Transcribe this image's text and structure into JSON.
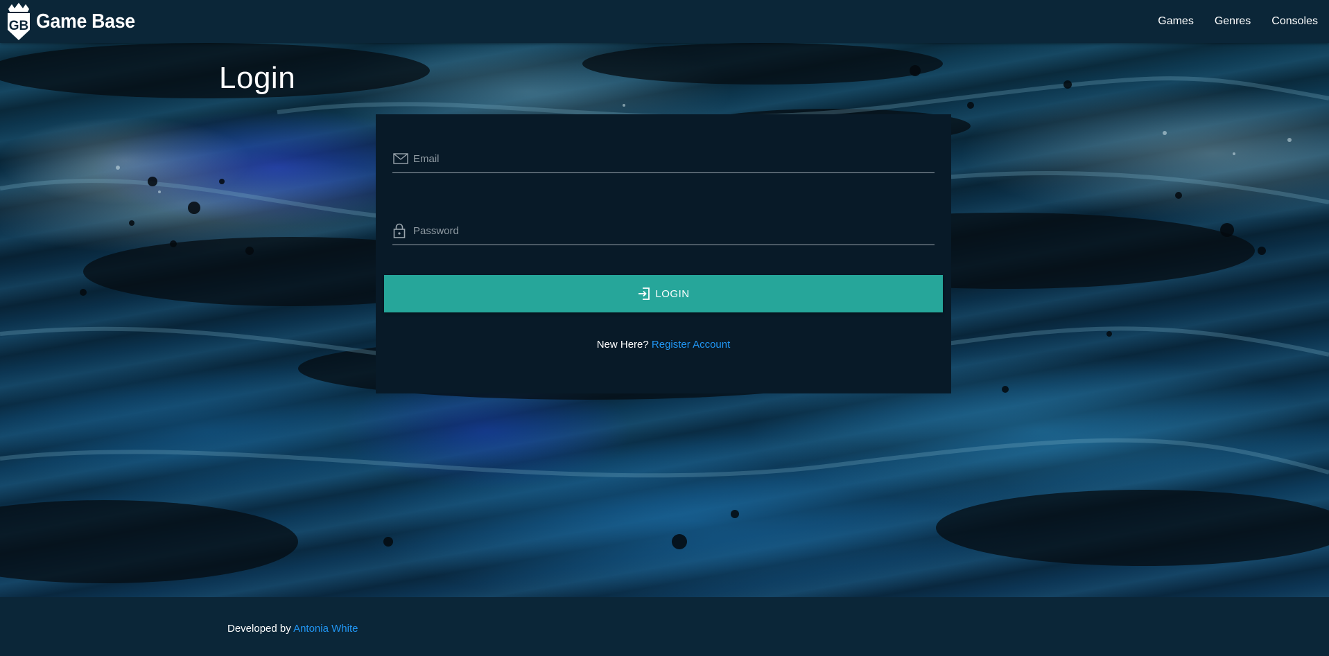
{
  "navbar": {
    "brand_name": "Game Base",
    "logo_icon": "gb-crown-shield-logo",
    "links": [
      {
        "label": "Games"
      },
      {
        "label": "Genres"
      },
      {
        "label": "Consoles"
      }
    ]
  },
  "page": {
    "title": "Login"
  },
  "form": {
    "email": {
      "placeholder": "Email",
      "value": "",
      "icon": "mail-icon"
    },
    "password": {
      "placeholder": "Password",
      "value": "",
      "icon": "lock-icon"
    },
    "submit_label": "LOGIN",
    "submit_icon": "login-icon",
    "register_prompt": "New Here?",
    "register_link": "Register Account"
  },
  "footer": {
    "developed_by": "Developed by",
    "developer_name": "Antonia White"
  },
  "colors": {
    "navbar_bg": "#0b2638",
    "card_bg": "#081a28",
    "button_bg": "#26a69a",
    "link": "#2196f3"
  }
}
